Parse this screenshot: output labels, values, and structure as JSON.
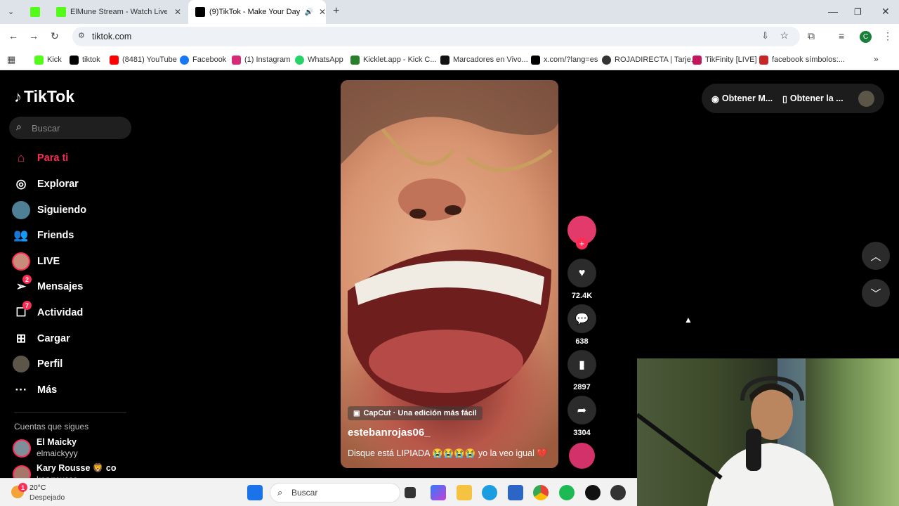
{
  "browser": {
    "tabs": [
      {
        "title": "ElMune Stream - Watch Live on",
        "favicon": "kick",
        "active": false
      },
      {
        "title": "(9)TikTok - Make Your Day",
        "favicon": "tiktok",
        "active": true
      }
    ],
    "new_tab_icon": "plus-icon",
    "url": "tiktok.com",
    "bookmarks": [
      {
        "label": "Kick",
        "color": "#53fc18"
      },
      {
        "label": "tiktok",
        "color": "#000000"
      },
      {
        "label": "(8481) YouTube",
        "color": "#ff0000"
      },
      {
        "label": "Facebook",
        "color": "#1877f2"
      },
      {
        "label": "(1) Instagram",
        "color": "#d62976"
      },
      {
        "label": "WhatsApp",
        "color": "#25d366"
      },
      {
        "label": "Kicklet.app - Kick C...",
        "color": "#2a7d2a"
      },
      {
        "label": "Marcadores en Vivo...",
        "color": "#111111"
      },
      {
        "label": "x.com/?lang=es",
        "color": "#000000"
      },
      {
        "label": "ROJADIRECTA | Tarje...",
        "color": "#333333"
      },
      {
        "label": "TikFinity [LIVE]",
        "color": "#c2185b"
      },
      {
        "label": "facebook símbolos:...",
        "color": "#c62828"
      }
    ],
    "profile_initial": "C"
  },
  "tiktok": {
    "logo": "TikTok",
    "search_placeholder": "Buscar",
    "nav": [
      {
        "label": "Para ti",
        "icon": "home-icon",
        "active": true
      },
      {
        "label": "Explorar",
        "icon": "compass-icon"
      },
      {
        "label": "Siguiendo",
        "icon": "following-avatar-icon"
      },
      {
        "label": "Friends",
        "icon": "friends-icon"
      },
      {
        "label": "LIVE",
        "icon": "live-avatar-icon"
      },
      {
        "label": "Mensajes",
        "icon": "send-icon",
        "badge": "2"
      },
      {
        "label": "Actividad",
        "icon": "inbox-icon",
        "badge": "7"
      },
      {
        "label": "Cargar",
        "icon": "upload-icon"
      },
      {
        "label": "Perfil",
        "icon": "profile-avatar-icon"
      },
      {
        "label": "Más",
        "icon": "more-icon"
      }
    ],
    "following_header": "Cuentas que sigues",
    "following": [
      {
        "name": "El Maicky",
        "handle": "elmaickyyy"
      },
      {
        "name": "Kary Rousse 🦁 co",
        "handle": "karyrousse"
      }
    ],
    "top_buttons": [
      "Obtener M...",
      "Obtener la ..."
    ],
    "video": {
      "effect_tag": "CapCut · Una edición más fácil",
      "author": "estebanrojas06_",
      "caption": "Disque está LIPIADA 😭😭😭😭 yo la veo igual 💔"
    },
    "actions": {
      "likes": "72.4K",
      "comments": "638",
      "saves": "2897",
      "shares": "3304"
    }
  },
  "taskbar": {
    "temperature": "20°C",
    "weather": "Despejado",
    "weather_badge": "1",
    "search_placeholder": "Buscar"
  }
}
